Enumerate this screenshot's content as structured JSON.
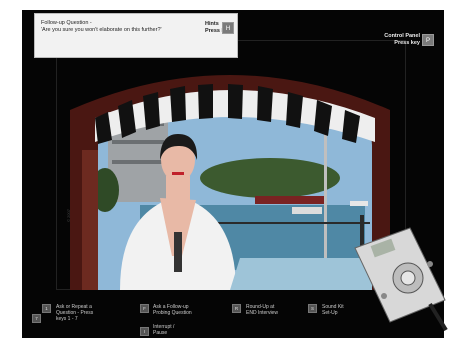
{
  "tooltip": {
    "question_line1": "Follow-up Question -",
    "question_line2": "'Are you sure you won't elaborate on this further?'",
    "hint_line1": "Hints",
    "hint_line2": "Press key",
    "hint_key": "H"
  },
  "control_panel": {
    "label_line1": "Control Panel",
    "label_line2": "Press key",
    "key": "P"
  },
  "bottom_menu": [
    {
      "key": "1",
      "label1": "Ask or Repeat a",
      "label2": "Question - Press",
      "label3": "keys 1 - 7"
    },
    {
      "key": "F",
      "label1": "Ask a Follow-up",
      "label2": "Probing Question",
      "label3": ""
    },
    {
      "key": "R",
      "label1": "Round-Up at",
      "label2": "END Interview",
      "label3": ""
    },
    {
      "key": "S",
      "label1": "Sound Kit",
      "label2": "Set-Up",
      "label3": ""
    },
    {
      "key": "I",
      "label1": "Interrupt /",
      "label2": "Pause",
      "label3": ""
    },
    {
      "key": "7",
      "label1": "",
      "label2": "",
      "label3": ""
    }
  ],
  "colors": {
    "background": "#050505",
    "awning_stripe": "#111111",
    "awning_light": "#eeeeee",
    "wall": "#4a1712",
    "sky": "#8fb8d8",
    "water": "#4f88a5"
  }
}
